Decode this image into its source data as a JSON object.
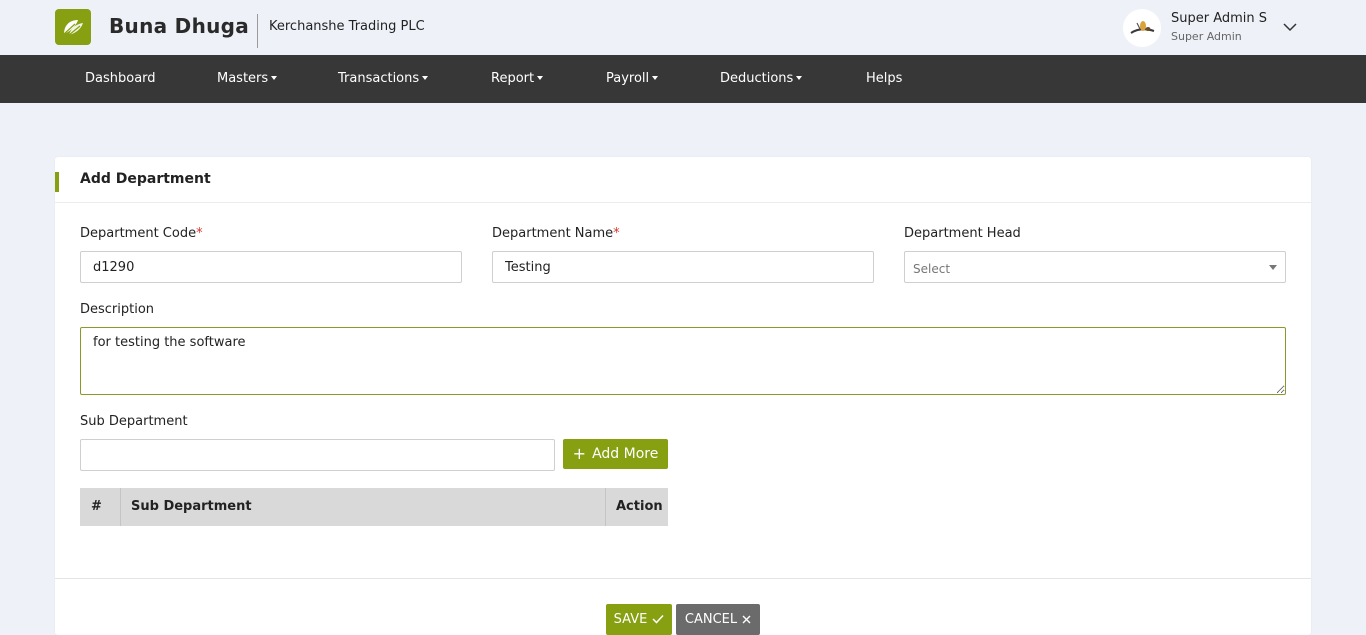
{
  "header": {
    "brand": "Buna Dhuga",
    "company": "Kerchanshe Trading PLC",
    "user_name": "Super Admin S",
    "user_role": "Super Admin"
  },
  "nav": {
    "items": [
      {
        "label": "Dashboard"
      },
      {
        "label": "Masters"
      },
      {
        "label": "Transactions"
      },
      {
        "label": "Report"
      },
      {
        "label": "Payroll"
      },
      {
        "label": "Deductions"
      },
      {
        "label": "Helps"
      }
    ]
  },
  "form": {
    "title": "Add Department",
    "department_code": {
      "label": "Department Code",
      "required_mark": "*",
      "value": "d1290"
    },
    "department_name": {
      "label": "Department Name",
      "required_mark": "*",
      "value": "Testing"
    },
    "department_head": {
      "label": "Department Head",
      "selected": "Select"
    },
    "description": {
      "label": "Description",
      "value": "for testing the software"
    },
    "sub_department": {
      "label": "Sub Department",
      "value": ""
    },
    "add_more_label": "Add More",
    "table": {
      "columns": [
        "#",
        "Sub Department",
        "Action"
      ],
      "rows": []
    },
    "save_label": "SAVE",
    "cancel_label": "CANCEL"
  },
  "colors": {
    "accent": "#86a011",
    "navbar": "#373737",
    "cancel": "#6b6b6b"
  }
}
